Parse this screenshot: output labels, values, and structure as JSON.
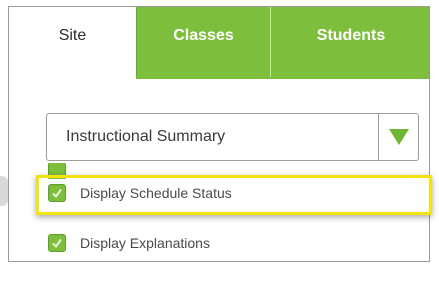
{
  "tabs": [
    {
      "label": "Site",
      "active": true
    },
    {
      "label": "Classes",
      "active": false
    },
    {
      "label": "Students",
      "active": false
    }
  ],
  "report_select": {
    "value": "Instructional Summary",
    "arrow_icon": "triangle-down-icon"
  },
  "options": [
    {
      "label": "Display Schedule Status",
      "checked": true,
      "highlighted": true
    },
    {
      "label": "Display Explanations",
      "checked": true,
      "highlighted": false
    }
  ],
  "colors": {
    "tab_green": "#7dbf3d",
    "highlight_yellow": "#f2e313"
  }
}
